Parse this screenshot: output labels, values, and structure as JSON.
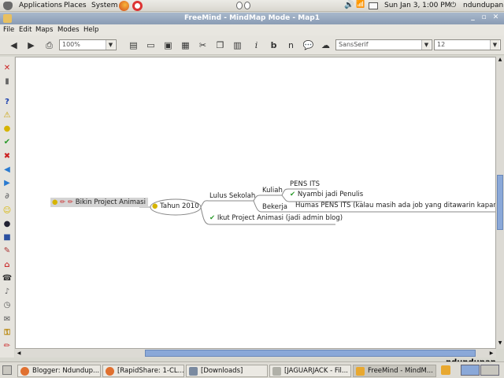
{
  "topbar": {
    "menus": [
      "Applications",
      "Places",
      "System"
    ],
    "clock": "Sun Jan  3,  1:00 PM",
    "user": "ndundupan"
  },
  "window": {
    "title": "FreeMind - MindMap Mode - Map1"
  },
  "menubar": [
    "File",
    "Edit",
    "Maps",
    "Modes",
    "Help"
  ],
  "toolbar": {
    "zoom": "100%",
    "font": "SansSerif",
    "font_size": "12"
  },
  "mindmap": {
    "root": "Bikin Project Animasi",
    "n1": "Tahun 2010",
    "n2": "Lulus Sekolah",
    "n3": "Kuliah",
    "n4": "PENS ITS",
    "n5": "Nyambi jadi Penulis",
    "n6": "Bekerja",
    "n7": "Humas PENS ITS (kalau masih ada job yang ditawarin kapan hari)",
    "n8": "Ikut Project Animasi (jadi admin blog)"
  },
  "canvas_user": "ndundupan",
  "taskbar": {
    "items": [
      "Blogger: Ndundup...",
      "[RapidShare: 1-CL...",
      "[Downloads]",
      "[JAGUARJACK - Fil...",
      "FreeMind - MindM..."
    ]
  }
}
